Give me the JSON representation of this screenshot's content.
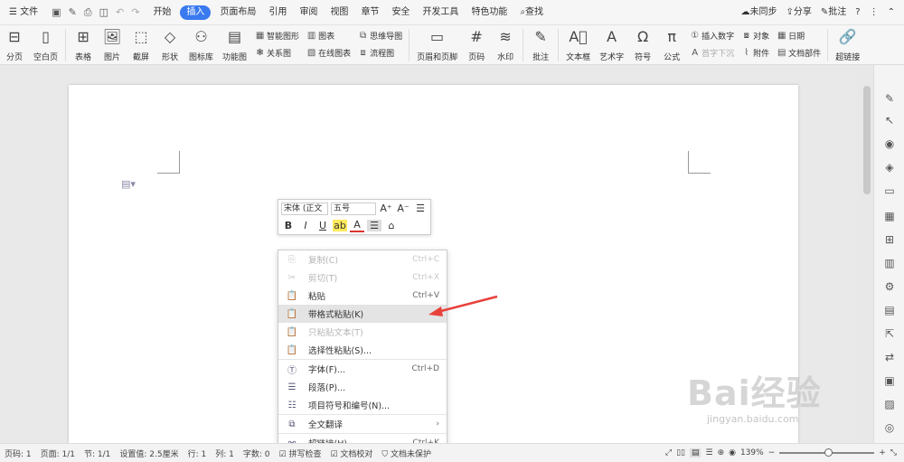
{
  "menubar": {
    "file": "文件",
    "tabs": [
      "开始",
      "插入",
      "页面布局",
      "引用",
      "审阅",
      "视图",
      "章节",
      "安全",
      "开发工具",
      "特色功能"
    ],
    "active_tab": "插入",
    "search": "查找",
    "sync": "未同步",
    "share": "分享",
    "comment": "批注",
    "help": "?"
  },
  "ribbon": {
    "big": [
      "分页",
      "空白页",
      "表格",
      "图片",
      "截屏",
      "形状",
      "图标库",
      "功能图"
    ],
    "col1": [
      "智能图形",
      "关系图"
    ],
    "col2": [
      "图表",
      "在线图表"
    ],
    "col3": [
      "思维导图",
      "流程图"
    ],
    "big2": [
      "页眉和页脚",
      "页码",
      "水印",
      "批注",
      "文本框",
      "艺术字",
      "符号",
      "公式"
    ],
    "col4": [
      "插入数字",
      "首字下沉"
    ],
    "col5": [
      "对象",
      "附件"
    ],
    "col6": [
      "日期",
      "文档部件"
    ],
    "big3": [
      "超链接"
    ]
  },
  "float_toolbar": {
    "font": "宋体 (正文",
    "size": "五号",
    "grow": "A⁺",
    "shrink": "A⁻",
    "bold": "B",
    "italic": "I",
    "underline": "U"
  },
  "context_menu": {
    "items": [
      {
        "label": "复制(C)",
        "shortcut": "Ctrl+C",
        "disabled": true,
        "icon": "copy"
      },
      {
        "label": "剪切(T)",
        "shortcut": "Ctrl+X",
        "disabled": true,
        "icon": "cut"
      },
      {
        "label": "粘贴",
        "shortcut": "Ctrl+V",
        "disabled": false,
        "icon": "paste"
      },
      {
        "label": "带格式粘贴(K)",
        "shortcut": "",
        "disabled": false,
        "icon": "paste-format",
        "highlight": true
      },
      {
        "label": "只粘贴文本(T)",
        "shortcut": "",
        "disabled": true,
        "icon": "paste-text"
      },
      {
        "label": "选择性粘贴(S)...",
        "shortcut": "",
        "disabled": false,
        "icon": "paste-special"
      },
      {
        "label": "字体(F)...",
        "shortcut": "Ctrl+D",
        "disabled": false,
        "icon": "font"
      },
      {
        "label": "段落(P)...",
        "shortcut": "",
        "disabled": false,
        "icon": "paragraph"
      },
      {
        "label": "项目符号和编号(N)...",
        "shortcut": "",
        "disabled": false,
        "icon": "list"
      },
      {
        "label": "全文翻译",
        "shortcut": "›",
        "disabled": false,
        "icon": "translate"
      },
      {
        "label": "超链接(H)...",
        "shortcut": "Ctrl+K",
        "disabled": false,
        "icon": "link"
      }
    ]
  },
  "status": {
    "page": "页码: 1",
    "pages": "页面: 1/1",
    "section": "节: 1/1",
    "setting": "设置值: 2.5厘米",
    "row": "行: 1",
    "col": "列: 1",
    "words": "字数: 0",
    "spell": "拼写检查",
    "proof": "文档校对",
    "unsaved": "文档未保护",
    "zoom": "139%",
    "zoom_minus": "−",
    "zoom_plus": "+"
  },
  "watermark": {
    "big": "Bai经验",
    "small": "jingyan.baidu.com"
  },
  "colors": {
    "accent": "#3a7af0",
    "arrow": "#e8413b"
  }
}
